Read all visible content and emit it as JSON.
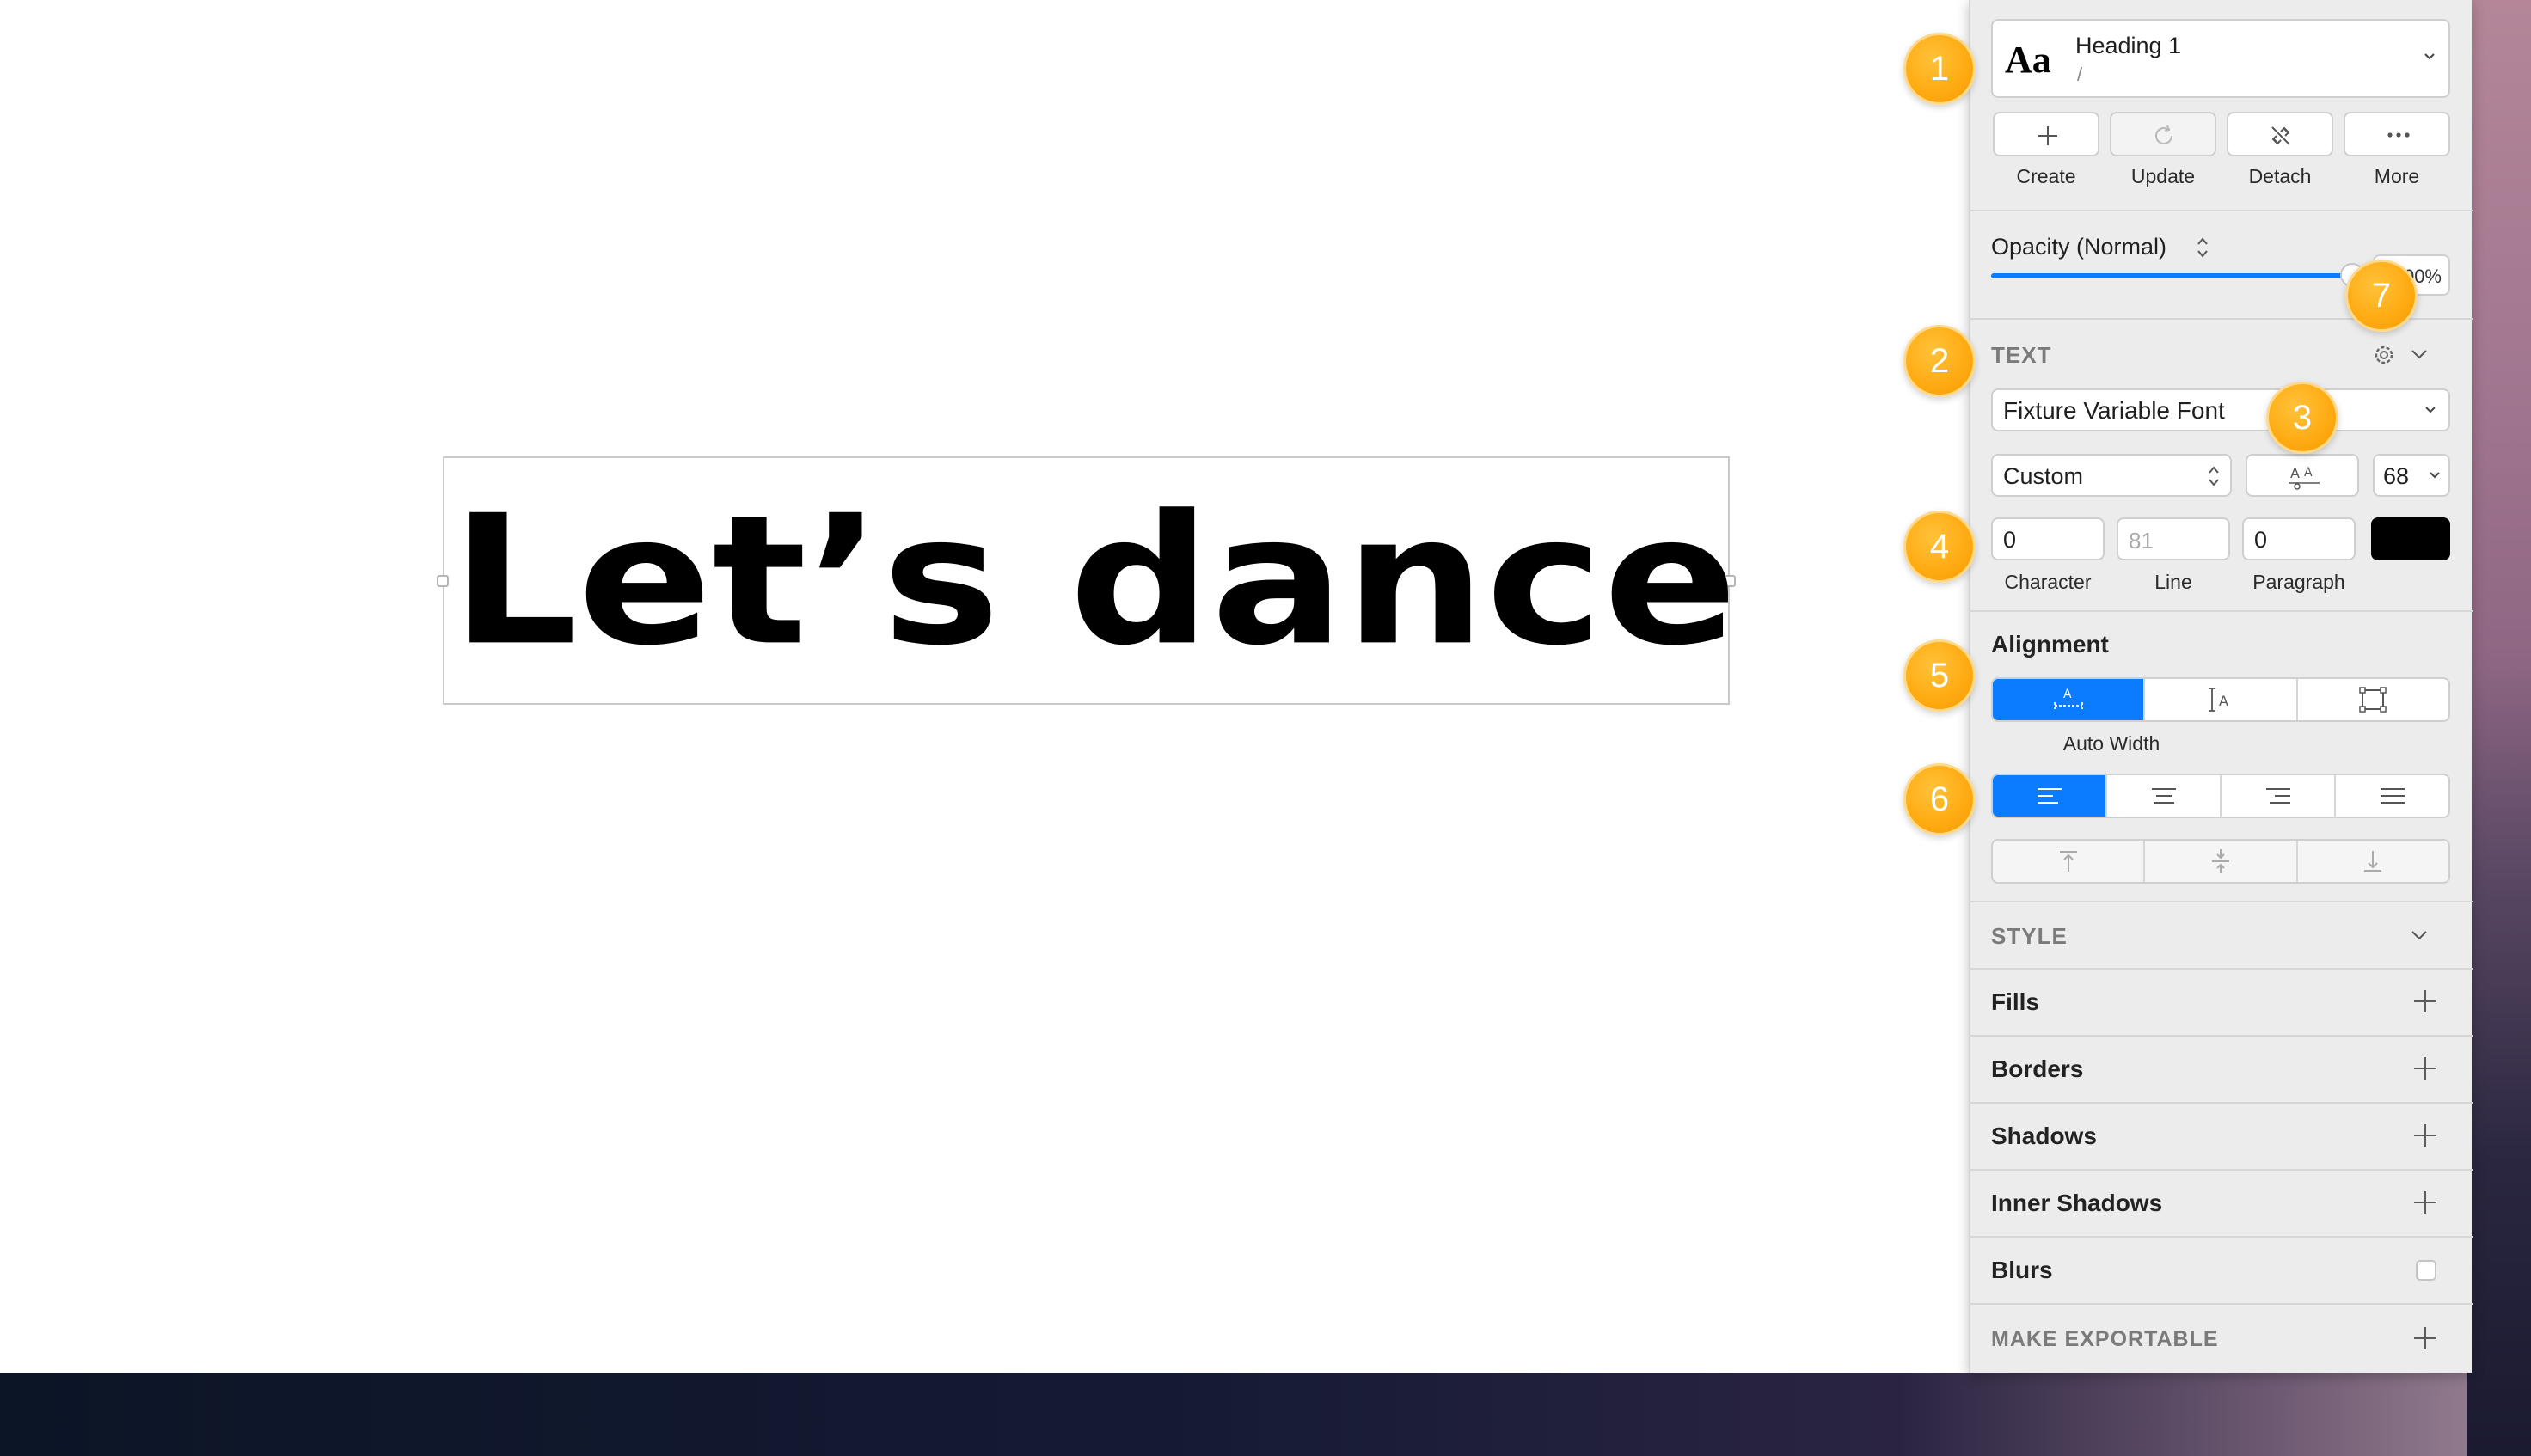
{
  "canvas": {
    "text": "Let’s dance"
  },
  "style_picker": {
    "preview_glyph": "Aa",
    "style_name": "Heading 1",
    "style_path": "/"
  },
  "style_actions": [
    {
      "label": "Create",
      "icon": "plus-icon"
    },
    {
      "label": "Update",
      "icon": "refresh-icon"
    },
    {
      "label": "Detach",
      "icon": "detach-link-icon"
    },
    {
      "label": "More",
      "icon": "more-dots-icon"
    }
  ],
  "opacity": {
    "label": "Opacity (Normal)",
    "value_text": "100%",
    "level": 1.0
  },
  "text_section": {
    "title": "TEXT",
    "font_family": "Fixture Variable Font",
    "font_weight": "Custom",
    "font_size": "68",
    "character_spacing": "0",
    "line_height_placeholder": "81",
    "paragraph_spacing": "0",
    "character_label": "Character",
    "line_label": "Line",
    "paragraph_label": "Paragraph",
    "text_color": "#000000"
  },
  "alignment": {
    "title": "Alignment",
    "sizing_modes": [
      "auto-width-icon",
      "auto-height-icon",
      "fixed-size-icon"
    ],
    "sizing_selected_label": "Auto Width",
    "horizontal": [
      "align-left-icon",
      "align-center-icon",
      "align-right-icon",
      "align-justify-icon"
    ],
    "vertical": [
      "align-top-icon",
      "align-middle-icon",
      "align-bottom-icon"
    ]
  },
  "style_section": {
    "title": "STYLE",
    "rows": [
      "Fills",
      "Borders",
      "Shadows",
      "Inner Shadows",
      "Blurs"
    ]
  },
  "export": {
    "title": "MAKE EXPORTABLE"
  },
  "badges": [
    "1",
    "2",
    "3",
    "4",
    "5",
    "6",
    "7"
  ],
  "colors": {
    "accent": "#0B7BFF",
    "badge": "#FFAC14"
  }
}
